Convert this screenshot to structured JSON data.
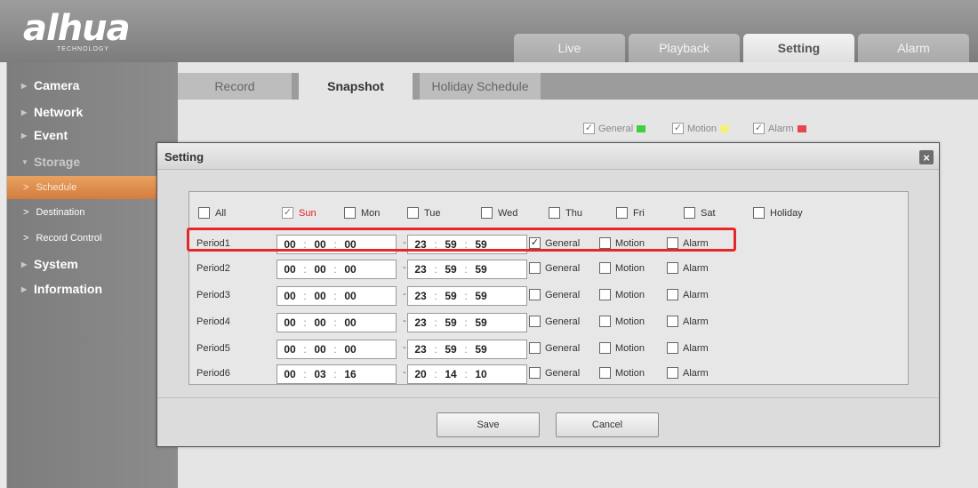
{
  "brand": {
    "logo": "alhua",
    "tagline": "TECHNOLOGY"
  },
  "top_tabs": [
    {
      "label": "Live",
      "active": false
    },
    {
      "label": "Playback",
      "active": false
    },
    {
      "label": "Setting",
      "active": true
    },
    {
      "label": "Alarm",
      "active": false
    }
  ],
  "sidebar": {
    "camera": "Camera",
    "network": "Network",
    "event": "Event",
    "storage": "Storage",
    "schedule": "Schedule",
    "destination": "Destination",
    "record_control": "Record Control",
    "system": "System",
    "information": "Information"
  },
  "sub_tabs": [
    {
      "label": "Record",
      "active": false
    },
    {
      "label": "Snapshot",
      "active": true
    },
    {
      "label": "Holiday Schedule",
      "active": false
    }
  ],
  "legend": {
    "general": "General",
    "motion": "Motion",
    "alarm": "Alarm",
    "colors": {
      "general": "#3fcf3f",
      "motion": "#f2f27a",
      "alarm": "#e6474e"
    }
  },
  "dialog": {
    "title": "Setting",
    "close": "×",
    "days": [
      {
        "label": "All",
        "checked": false
      },
      {
        "label": "Sun",
        "checked": true
      },
      {
        "label": "Mon",
        "checked": false
      },
      {
        "label": "Tue",
        "checked": false
      },
      {
        "label": "Wed",
        "checked": false
      },
      {
        "label": "Thu",
        "checked": false
      },
      {
        "label": "Fri",
        "checked": false
      },
      {
        "label": "Sat",
        "checked": false
      },
      {
        "label": "Holiday",
        "checked": false
      }
    ],
    "option_labels": {
      "general": "General",
      "motion": "Motion",
      "alarm": "Alarm"
    },
    "periods": [
      {
        "label": "Period1",
        "start": [
          "00",
          "00",
          "00"
        ],
        "end": [
          "23",
          "59",
          "59"
        ],
        "general": true,
        "motion": false,
        "alarm": false
      },
      {
        "label": "Period2",
        "start": [
          "00",
          "00",
          "00"
        ],
        "end": [
          "23",
          "59",
          "59"
        ],
        "general": false,
        "motion": false,
        "alarm": false
      },
      {
        "label": "Period3",
        "start": [
          "00",
          "00",
          "00"
        ],
        "end": [
          "23",
          "59",
          "59"
        ],
        "general": false,
        "motion": false,
        "alarm": false
      },
      {
        "label": "Period4",
        "start": [
          "00",
          "00",
          "00"
        ],
        "end": [
          "23",
          "59",
          "59"
        ],
        "general": false,
        "motion": false,
        "alarm": false
      },
      {
        "label": "Period5",
        "start": [
          "00",
          "00",
          "00"
        ],
        "end": [
          "23",
          "59",
          "59"
        ],
        "general": false,
        "motion": false,
        "alarm": false
      },
      {
        "label": "Period6",
        "start": [
          "00",
          "03",
          "16"
        ],
        "end": [
          "20",
          "14",
          "10"
        ],
        "general": false,
        "motion": false,
        "alarm": false
      }
    ],
    "save": "Save",
    "cancel": "Cancel"
  }
}
